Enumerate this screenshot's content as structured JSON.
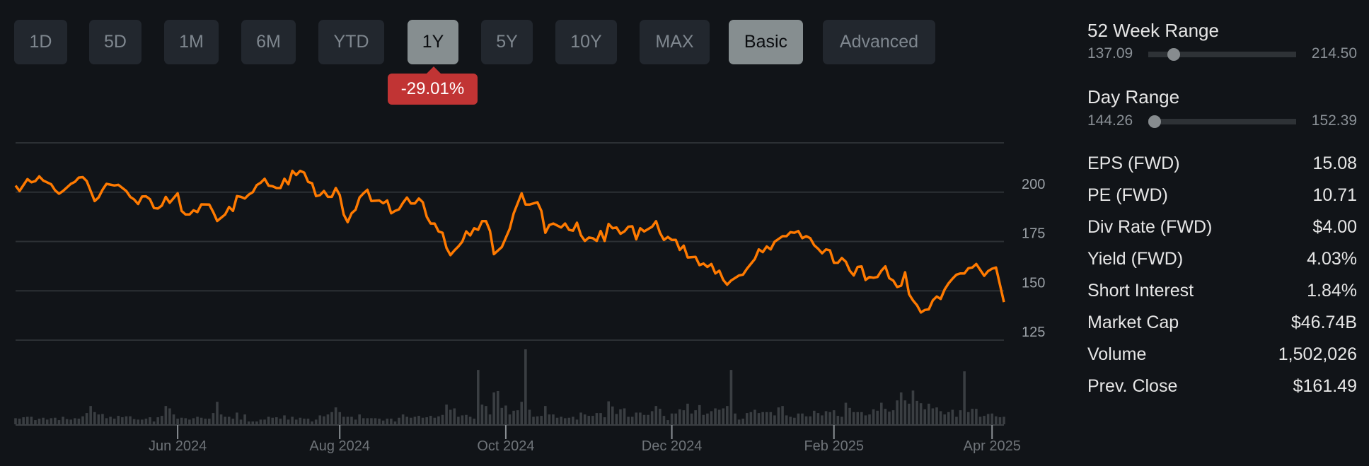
{
  "range_buttons": [
    {
      "label": "1D",
      "active": false
    },
    {
      "label": "5D",
      "active": false
    },
    {
      "label": "1M",
      "active": false
    },
    {
      "label": "6M",
      "active": false
    },
    {
      "label": "YTD",
      "active": false
    },
    {
      "label": "1Y",
      "active": true
    },
    {
      "label": "5Y",
      "active": false
    },
    {
      "label": "10Y",
      "active": false
    },
    {
      "label": "MAX",
      "active": false
    }
  ],
  "mode_buttons": [
    {
      "label": "Basic",
      "active": true
    },
    {
      "label": "Advanced",
      "active": false
    }
  ],
  "change_badge": "-29.01%",
  "colors": {
    "line": "#ff7a00",
    "volume": "#3a3e42",
    "badge": "#c13434",
    "grid": "#2c3034"
  },
  "week52": {
    "title": "52 Week Range",
    "low": "137.09",
    "high": "214.50",
    "position": 0.13
  },
  "day_range": {
    "title": "Day Range",
    "low": "144.26",
    "high": "152.39",
    "position": 0.0
  },
  "stats": [
    {
      "label": "EPS (FWD)",
      "value": "15.08"
    },
    {
      "label": "PE (FWD)",
      "value": "10.71"
    },
    {
      "label": "Div Rate (FWD)",
      "value": "$4.00"
    },
    {
      "label": "Yield (FWD)",
      "value": "4.03%"
    },
    {
      "label": "Short Interest",
      "value": "1.84%"
    },
    {
      "label": "Market Cap",
      "value": "$46.74B"
    },
    {
      "label": "Volume",
      "value": "1,502,026"
    },
    {
      "label": "Prev. Close",
      "value": "$161.49"
    }
  ],
  "chart_data": {
    "type": "line",
    "xlabel": "",
    "ylabel": "",
    "x_unit": "trading day index (1Y)",
    "xlim": [
      0,
      250
    ],
    "ylim": [
      125,
      225
    ],
    "grid": true,
    "y_ticks": [
      {
        "value": 225,
        "label": ""
      },
      {
        "value": 200,
        "label": "200"
      },
      {
        "value": 175,
        "label": "175"
      },
      {
        "value": 150,
        "label": "150"
      },
      {
        "value": 125,
        "label": "125"
      }
    ],
    "x_ticks": [
      {
        "day": 41,
        "label": "Jun 2024"
      },
      {
        "day": 82,
        "label": "Aug 2024"
      },
      {
        "day": 124,
        "label": "Oct 2024"
      },
      {
        "day": 166,
        "label": "Dec 2024"
      },
      {
        "day": 207,
        "label": "Feb 2025"
      },
      {
        "day": 247,
        "label": "Apr 2025"
      }
    ],
    "price": [
      [
        0,
        203.3
      ],
      [
        1,
        200.6
      ],
      [
        3,
        206.6
      ],
      [
        4,
        205.0
      ],
      [
        5,
        205.6
      ],
      [
        6,
        208.0
      ],
      [
        7,
        205.9
      ],
      [
        9,
        204.0
      ],
      [
        10,
        200.9
      ],
      [
        11,
        199.2
      ],
      [
        12,
        200.6
      ],
      [
        14,
        204.2
      ],
      [
        15,
        205.2
      ],
      [
        16,
        207.4
      ],
      [
        17,
        207.6
      ],
      [
        18,
        205.6
      ],
      [
        20,
        195.5
      ],
      [
        21,
        197.3
      ],
      [
        22,
        201.2
      ],
      [
        23,
        204.2
      ],
      [
        25,
        203.4
      ],
      [
        26,
        203.7
      ],
      [
        28,
        200.6
      ],
      [
        29,
        197.6
      ],
      [
        30,
        196.3
      ],
      [
        31,
        194.0
      ],
      [
        32,
        197.8
      ],
      [
        33,
        197.9
      ],
      [
        34,
        196.4
      ],
      [
        35,
        192.0
      ],
      [
        36,
        191.7
      ],
      [
        37,
        193.2
      ],
      [
        38,
        197.6
      ],
      [
        39,
        194.6
      ],
      [
        41,
        199.4
      ],
      [
        42,
        190.5
      ],
      [
        43,
        188.7
      ],
      [
        44,
        188.7
      ],
      [
        45,
        190.8
      ],
      [
        46,
        189.9
      ],
      [
        47,
        193.8
      ],
      [
        49,
        193.7
      ],
      [
        50,
        189.9
      ],
      [
        51,
        185.4
      ],
      [
        53,
        188.7
      ],
      [
        54,
        192.5
      ],
      [
        55,
        190.5
      ],
      [
        56,
        198.0
      ],
      [
        57,
        197.6
      ],
      [
        58,
        196.8
      ],
      [
        59,
        198.8
      ],
      [
        60,
        200.0
      ],
      [
        61,
        203.6
      ],
      [
        62,
        204.8
      ],
      [
        63,
        206.8
      ],
      [
        64,
        203.3
      ],
      [
        65,
        203.0
      ],
      [
        66,
        202.1
      ],
      [
        67,
        202.1
      ],
      [
        68,
        206.8
      ],
      [
        69,
        204.0
      ],
      [
        70,
        210.8
      ],
      [
        71,
        208.7
      ],
      [
        72,
        210.8
      ],
      [
        73,
        209.9
      ],
      [
        74,
        205.2
      ],
      [
        75,
        204.5
      ],
      [
        76,
        198.0
      ],
      [
        77,
        198.5
      ],
      [
        78,
        200.6
      ],
      [
        79,
        197.6
      ],
      [
        80,
        197.6
      ],
      [
        81,
        202.1
      ],
      [
        82,
        198.5
      ],
      [
        83,
        188.7
      ],
      [
        84,
        184.8
      ],
      [
        85,
        189.3
      ],
      [
        86,
        191.1
      ],
      [
        87,
        197.3
      ],
      [
        88,
        199.4
      ],
      [
        89,
        201.2
      ],
      [
        90,
        195.5
      ],
      [
        92,
        195.8
      ],
      [
        93,
        194.4
      ],
      [
        94,
        195.8
      ],
      [
        95,
        189.3
      ],
      [
        96,
        190.5
      ],
      [
        97,
        191.3
      ],
      [
        98,
        194.6
      ],
      [
        99,
        197.3
      ],
      [
        100,
        194.3
      ],
      [
        101,
        194.3
      ],
      [
        102,
        196.8
      ],
      [
        103,
        194.9
      ],
      [
        104,
        187.5
      ],
      [
        105,
        184.1
      ],
      [
        106,
        184.1
      ],
      [
        107,
        180.1
      ],
      [
        108,
        179.4
      ],
      [
        109,
        171.7
      ],
      [
        110,
        168.1
      ],
      [
        111,
        170.5
      ],
      [
        112,
        172.5
      ],
      [
        113,
        174.9
      ],
      [
        114,
        180.1
      ],
      [
        115,
        178.1
      ],
      [
        116,
        181.7
      ],
      [
        117,
        180.9
      ],
      [
        118,
        185.3
      ],
      [
        119,
        185.3
      ],
      [
        120,
        180.3
      ],
      [
        121,
        168.6
      ],
      [
        123,
        172.2
      ],
      [
        125,
        181.5
      ],
      [
        126,
        189.3
      ],
      [
        128,
        199.4
      ],
      [
        129,
        193.7
      ],
      [
        130,
        193.7
      ],
      [
        132,
        194.9
      ],
      [
        133,
        190.5
      ],
      [
        134,
        179.4
      ],
      [
        135,
        183.3
      ],
      [
        136,
        184.1
      ],
      [
        138,
        182.1
      ],
      [
        139,
        184.1
      ],
      [
        140,
        180.9
      ],
      [
        141,
        180.5
      ],
      [
        142,
        184.5
      ],
      [
        143,
        178.2
      ],
      [
        144,
        175.3
      ],
      [
        145,
        177.0
      ],
      [
        146,
        176.7
      ],
      [
        147,
        175.3
      ],
      [
        148,
        180.3
      ],
      [
        149,
        175.3
      ],
      [
        150,
        183.9
      ],
      [
        151,
        181.7
      ],
      [
        152,
        182.1
      ],
      [
        153,
        178.9
      ],
      [
        154,
        180.1
      ],
      [
        155,
        182.5
      ],
      [
        156,
        182.7
      ],
      [
        157,
        176.1
      ],
      [
        158,
        181.7
      ],
      [
        159,
        180.1
      ],
      [
        161,
        182.5
      ],
      [
        162,
        185.3
      ],
      [
        163,
        179.4
      ],
      [
        164,
        175.8
      ],
      [
        165,
        177.3
      ],
      [
        166,
        175.8
      ],
      [
        167,
        175.8
      ],
      [
        168,
        170.7
      ],
      [
        169,
        172.9
      ],
      [
        170,
        166.9
      ],
      [
        172,
        167.2
      ],
      [
        173,
        163.0
      ],
      [
        174,
        163.8
      ],
      [
        175,
        162.1
      ],
      [
        176,
        163.6
      ],
      [
        177,
        158.8
      ],
      [
        178,
        160.2
      ],
      [
        179,
        155.5
      ],
      [
        180,
        153.1
      ],
      [
        181,
        155.2
      ],
      [
        183,
        157.8
      ],
      [
        184,
        158.2
      ],
      [
        185,
        161.2
      ],
      [
        187,
        166.2
      ],
      [
        188,
        171.0
      ],
      [
        189,
        169.6
      ],
      [
        190,
        172.5
      ],
      [
        191,
        171.0
      ],
      [
        192,
        174.9
      ],
      [
        194,
        177.7
      ],
      [
        195,
        177.7
      ],
      [
        196,
        179.7
      ],
      [
        197,
        179.4
      ],
      [
        198,
        180.3
      ],
      [
        199,
        176.7
      ],
      [
        200,
        177.7
      ],
      [
        201,
        176.7
      ],
      [
        202,
        173.1
      ],
      [
        203,
        171.3
      ],
      [
        204,
        169.0
      ],
      [
        205,
        171.0
      ],
      [
        206,
        170.5
      ],
      [
        207,
        164.2
      ],
      [
        208,
        164.2
      ],
      [
        209,
        166.6
      ],
      [
        210,
        164.8
      ],
      [
        211,
        160.2
      ],
      [
        212,
        157.8
      ],
      [
        213,
        162.1
      ],
      [
        214,
        162.4
      ],
      [
        215,
        155.5
      ],
      [
        216,
        157.0
      ],
      [
        217,
        156.6
      ],
      [
        218,
        157.0
      ],
      [
        219,
        160.2
      ],
      [
        220,
        162.4
      ],
      [
        221,
        156.4
      ],
      [
        222,
        155.2
      ],
      [
        223,
        151.9
      ],
      [
        224,
        152.6
      ],
      [
        225,
        159.4
      ],
      [
        226,
        148.3
      ],
      [
        227,
        145.1
      ],
      [
        228,
        142.7
      ],
      [
        229,
        139.0
      ],
      [
        230,
        140.3
      ],
      [
        231,
        140.6
      ],
      [
        232,
        145.1
      ],
      [
        233,
        147.1
      ],
      [
        234,
        145.9
      ],
      [
        235,
        150.7
      ],
      [
        236,
        153.8
      ],
      [
        237,
        156.2
      ],
      [
        238,
        158.2
      ],
      [
        239,
        158.8
      ],
      [
        240,
        158.8
      ],
      [
        241,
        161.4
      ],
      [
        242,
        161.8
      ],
      [
        243,
        163.6
      ],
      [
        244,
        160.6
      ],
      [
        245,
        157.6
      ],
      [
        246,
        160.0
      ],
      [
        247,
        161.2
      ],
      [
        248,
        161.8
      ],
      [
        250,
        144.3
      ]
    ],
    "volume_unit": "millions",
    "volume_ylim": [
      0,
      16
    ],
    "volume": [
      1.3,
      1.2,
      1.5,
      1.6,
      1.6,
      0.9,
      1.2,
      1.4,
      1.0,
      1.3,
      1.4,
      0.9,
      1.6,
      1.1,
      1.0,
      1.3,
      1.2,
      1.7,
      2.4,
      3.9,
      2.6,
      2.1,
      2.2,
      1.3,
      1.6,
      1.2,
      1.8,
      1.5,
      1.7,
      1.7,
      1.1,
      1.0,
      1.0,
      1.2,
      1.5,
      0.6,
      1.5,
      1.8,
      3.9,
      3.4,
      2.1,
      1.2,
      1.4,
      1.3,
      1.0,
      1.3,
      1.6,
      1.4,
      1.2,
      1.2,
      2.4,
      4.8,
      2.1,
      1.6,
      1.6,
      1.2,
      2.5,
      1.0,
      2.1,
      0.6,
      0.6,
      0.6,
      1.0,
      1.0,
      1.6,
      1.4,
      1.5,
      1.2,
      1.9,
      1.0,
      1.6,
      1.0,
      1.4,
      1.2,
      1.2,
      0.6,
      1.0,
      1.9,
      1.7,
      2.1,
      2.6,
      3.6,
      2.6,
      1.6,
      1.6,
      1.6,
      1.0,
      2.1,
      1.3,
      1.3,
      1.3,
      1.3,
      1.2,
      0.8,
      1.2,
      1.2,
      0.6,
      1.4,
      2.1,
      1.6,
      1.4,
      1.6,
      1.8,
      1.4,
      1.5,
      1.8,
      1.4,
      1.7,
      2.0,
      4.2,
      3.1,
      3.4,
      1.6,
      1.9,
      2.0,
      1.6,
      1.2,
      11.6,
      4.2,
      3.9,
      2.1,
      6.8,
      7.1,
      3.5,
      4.0,
      2.1,
      2.9,
      3.0,
      4.8,
      16.0,
      3.1,
      1.6,
      1.7,
      1.8,
      3.9,
      2.1,
      2.1,
      1.4,
      1.6,
      1.3,
      1.4,
      1.6,
      1.0,
      2.5,
      2.1,
      1.8,
      1.8,
      2.4,
      2.4,
      1.5,
      4.9,
      3.8,
      2.2,
      3.2,
      3.4,
      1.6,
      1.6,
      2.5,
      2.5,
      2.0,
      2.0,
      2.8,
      3.9,
      3.3,
      1.8,
      0.9,
      2.3,
      2.3,
      3.2,
      3.0,
      4.4,
      2.3,
      3.0,
      4.1,
      2.0,
      2.3,
      2.8,
      3.4,
      3.1,
      3.4,
      3.9,
      11.6,
      2.3,
      1.0,
      1.2,
      2.4,
      2.6,
      3.1,
      2.4,
      2.6,
      2.6,
      2.6,
      1.9,
      3.6,
      3.9,
      1.9,
      1.6,
      1.4,
      2.3,
      2.3,
      1.7,
      1.7,
      2.9,
      2.4,
      1.9,
      2.8,
      2.6,
      3.0,
      1.8,
      1.6,
      4.6,
      3.5,
      2.6,
      2.6,
      2.6,
      1.9,
      2.1,
      3.2,
      2.9,
      4.6,
      3.3,
      2.7,
      3.0,
      5.1,
      6.8,
      5.1,
      4.4,
      7.2,
      5.0,
      4.5,
      3.2,
      4.4,
      3.4,
      3.6,
      2.8,
      2.1,
      2.6,
      3.1,
      1.6,
      3.0,
      11.3,
      2.6,
      3.3,
      3.3,
      1.6,
      1.8,
      2.2,
      2.3,
      1.7,
      1.5,
      1.6
    ]
  }
}
